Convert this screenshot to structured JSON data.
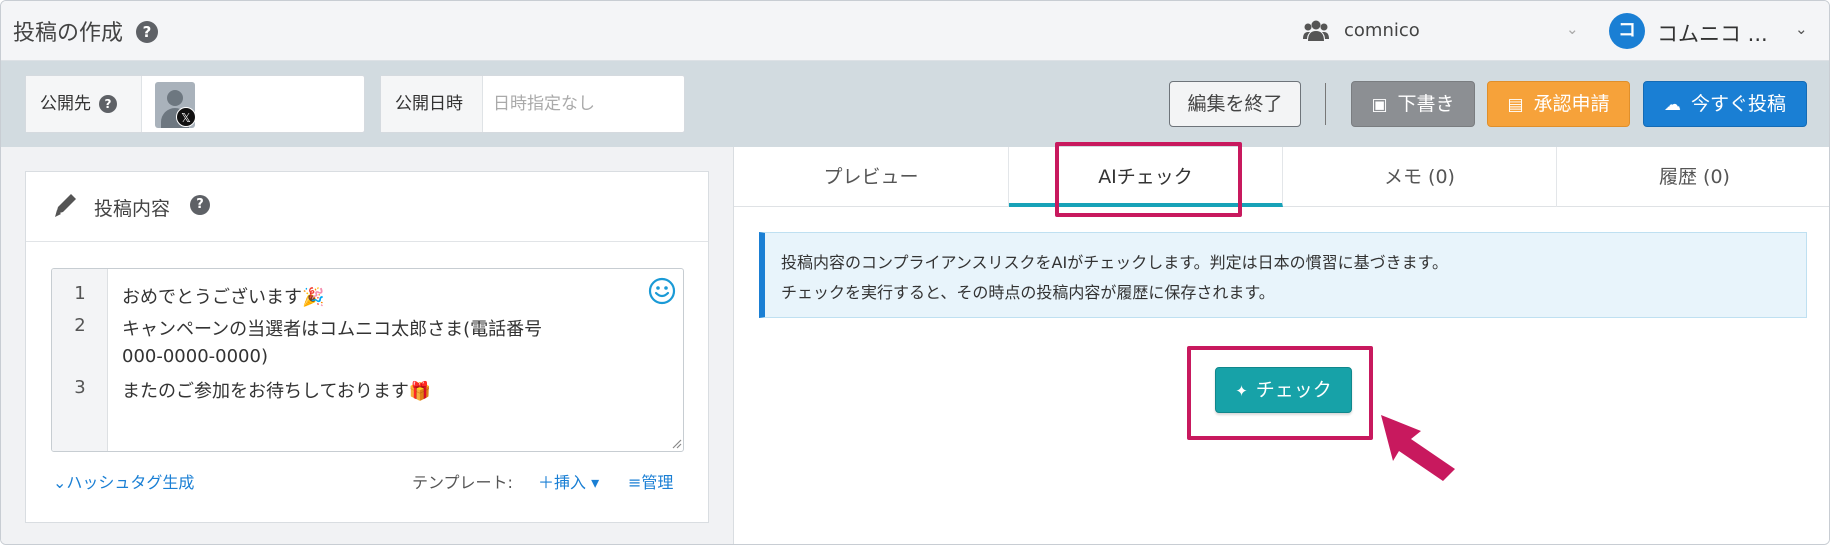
{
  "header": {
    "title": "投稿の作成",
    "workspace": "comnico",
    "user_initial": "コ",
    "user_name": "コムニコ ..."
  },
  "toolbar": {
    "destination_label": "公開先",
    "publish_date_label": "公開日時",
    "publish_date_value": "日時指定なし",
    "finish_edit": "編集を終了",
    "draft": "下書き",
    "approval": "承認申請",
    "post_now": "今すぐ投稿"
  },
  "editor_card": {
    "title": "投稿内容",
    "lines": [
      {
        "num": "1",
        "text": "おめでとうございます🎉"
      },
      {
        "num": "2",
        "text": "キャンペーンの当選者はコムニコ太郎さま(電話番号",
        "cont": "000-0000-0000)"
      },
      {
        "num": "3",
        "text": "またのご参加をお待ちしております🎁"
      }
    ],
    "hashtag_link": "⌄ハッシュタグ生成",
    "template_label": "テンプレート:",
    "template_insert": "＋挿入 ▾",
    "template_manage": "≡管理"
  },
  "tabs": [
    {
      "label": "プレビュー"
    },
    {
      "label": "AIチェック"
    },
    {
      "label": "メモ (0)"
    },
    {
      "label": "履歴 (0)"
    }
  ],
  "info": {
    "line1": "投稿内容のコンプライアンスリスクをAIがチェックします。判定は日本の慣習に基づきます。",
    "line2": "チェックを実行すると、その時点の投稿内容が履歴に保存されます。"
  },
  "check_button": "チェック",
  "colors": {
    "accent_blue": "#1a7fd4",
    "teal": "#17a2a8",
    "approval_orange": "#f6a23a",
    "highlight": "#c8195e"
  }
}
